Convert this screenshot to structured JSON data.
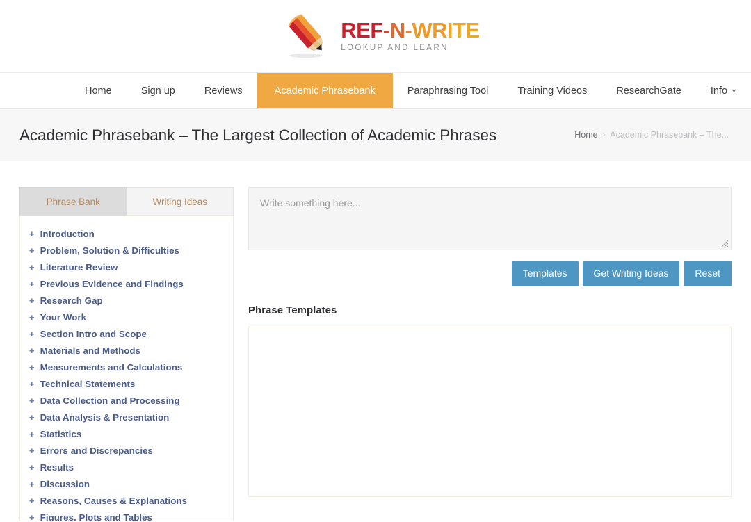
{
  "logo": {
    "icon": "pencil-icon",
    "title_parts": [
      {
        "text": "REF",
        "color": "#c8202c"
      },
      {
        "text": "-",
        "color": "#d4452c"
      },
      {
        "text": "N",
        "color": "#e0692b"
      },
      {
        "text": "-",
        "color": "#e8872a"
      },
      {
        "text": "WR",
        "color": "#ef9a26"
      },
      {
        "text": "ITE",
        "color": "#f0a81f"
      }
    ],
    "title_full": "REF-N-WRITE",
    "tagline": "LOOKUP AND LEARN"
  },
  "nav": {
    "items": [
      {
        "label": "Home",
        "active": false,
        "caret": false
      },
      {
        "label": "Sign up",
        "active": false,
        "caret": false
      },
      {
        "label": "Reviews",
        "active": false,
        "caret": false
      },
      {
        "label": "Academic Phrasebank",
        "active": true,
        "caret": false
      },
      {
        "label": "Paraphrasing Tool",
        "active": false,
        "caret": false
      },
      {
        "label": "Training Videos",
        "active": false,
        "caret": false
      },
      {
        "label": "ResearchGate",
        "active": false,
        "caret": false
      },
      {
        "label": "Info",
        "active": false,
        "caret": true
      }
    ],
    "active_color": "#f0a843"
  },
  "page_header": {
    "title": "Academic Phrasebank – The Largest Collection of Academic Phrases",
    "breadcrumb": {
      "home": "Home",
      "separator": "›",
      "current": "Academic Phrasebank – The..."
    }
  },
  "sidebar": {
    "tabs": [
      {
        "label": "Phrase Bank",
        "active": true
      },
      {
        "label": "Writing Ideas",
        "active": false
      }
    ],
    "expand_symbol": "+",
    "items": [
      {
        "label": "Introduction"
      },
      {
        "label": "Problem, Solution & Difficulties"
      },
      {
        "label": "Literature Review"
      },
      {
        "label": "Previous Evidence and Findings"
      },
      {
        "label": "Research Gap"
      },
      {
        "label": "Your Work"
      },
      {
        "label": "Section Intro and Scope"
      },
      {
        "label": "Materials and Methods"
      },
      {
        "label": "Measurements and Calculations"
      },
      {
        "label": "Technical Statements"
      },
      {
        "label": "Data Collection and Processing"
      },
      {
        "label": "Data Analysis & Presentation"
      },
      {
        "label": "Statistics"
      },
      {
        "label": "Errors and Discrepancies"
      },
      {
        "label": "Results"
      },
      {
        "label": "Discussion"
      },
      {
        "label": "Reasons, Causes & Explanations"
      },
      {
        "label": "Figures, Plots and Tables"
      }
    ]
  },
  "main": {
    "editor": {
      "placeholder": "Write something here...",
      "value": ""
    },
    "buttons": [
      {
        "label": "Templates"
      },
      {
        "label": "Get Writing Ideas"
      },
      {
        "label": "Reset"
      }
    ],
    "button_color": "#4e97c2",
    "templates_heading": "Phrase Templates",
    "templates_content": ""
  }
}
